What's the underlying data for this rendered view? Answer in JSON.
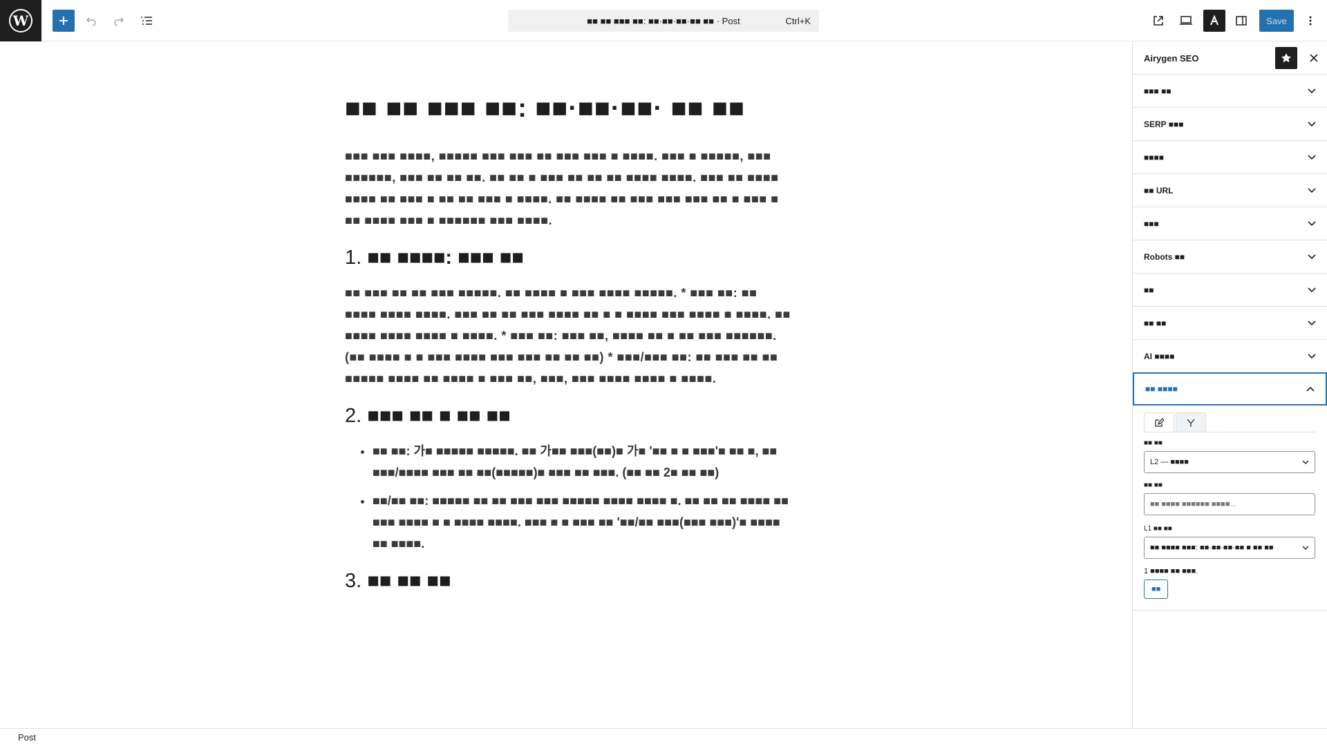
{
  "topbar": {
    "doc_title": "■■ ■■ ■■■ ■■: ■■·■■·■■·■■ ■■ · Post",
    "shortcut": "Ctrl+K",
    "save_label": "Save"
  },
  "post": {
    "title": "■■ ■■ ■■■ ■■: ■■·■■·■■· ■■ ■■",
    "intro": "■■■ ■■■ ■■■■, ■■■■■ ■■■ ■■■ ■■ ■■■ ■■■ ■ ■■■■. ■■■ ■ ■■■■■, ■■■ ■■■■■■, ■■■ ■■ ■■ ■■. ■■ ■■ ■ ■■■ ■■ ■■ ■■ ■■■■ ■■■■. ■■■ ■■ ■■■■ ■■■■ ■■ ■■■ ■ ■■ ■■ ■■■ ■ ■■■■. ■■ ■■■■ ■■ ■■■ ■■■ ■■■ ■■ ■ ■■■ ■ ■■ ■■■■ ■■■ ■ ■■■■■■ ■■■ ■■■■.",
    "h1_num": "1.",
    "h1_text": "■■ ■■■■: ■■■ ■■",
    "p1": "■■ ■■■ ■■ ■■ ■■■ ■■■■■. ■■ ■■■■ ■ ■■■ ■■■■ ■■■■■. * ■■■ ■■: ■■ ■■■■ ■■■■ ■■■■. ■■■ ■■ ■■ ■■■ ■■■■ ■■ ■ ■ ■■■■ ■■■ ■■■■ ■ ■■■■. ■■ ■■■■ ■■■■ ■■■■ ■ ■■■■. * ■■■ ■■: ■■■ ■■, ■■■■ ■■ ■ ■■ ■■■ ■■■■■■. (■■ ■■■■ ■ ■ ■■■ ■■■■ ■■■ ■■■ ■■ ■■ ■■) * ■■■/■■■ ■■: ■■ ■■■ ■■ ■■ ■■■■■ ■■■■ ■■ ■■■■ ■ ■■■ ■■, ■■■, ■■■ ■■■■ ■■■■ ■ ■■■■.",
    "h2_num": "2.",
    "h2_text": "■■■ ■■ ■ ■■ ■■",
    "bullets": [
      "■■ ■■: 가■ ■■■■■ ■■■■■. ■■ 가■■ ■■■(■■)■ 가■ '■■ ■ ■ ■■■'■ ■■ ■, ■■ ■■■/■■■■ ■■■ ■■ ■■(■■■■■)■ ■■■ ■■ ■■■. (■■ ■■ 2■ ■■ ■■)",
      "■■/■■ ■■: ■■■■■ ■■ ■■ ■■■ ■■■ ■■■■■ ■■■■ ■■■■ ■. ■■ ■■ ■■ ■■■■ ■■ ■■■ ■■■■ ■ ■ ■■■■ ■■■■. ■■■ ■ ■ ■■■ ■■ '■■/■■ ■■■(■■■ ■■■)'■ ■■■■ ■■ ■■■■."
    ],
    "h3_num": "3.",
    "h3_text": "■■ ■■ ■■"
  },
  "sidebar": {
    "title": "Airygen SEO",
    "panels": [
      "■■■ ■■",
      "SERP ■■■",
      "■■■■",
      "■■ URL",
      "■■■",
      "Robots ■■",
      "■■",
      "■■ ■■",
      "AI ■■■■"
    ],
    "open_panel": "■■ ■■■■",
    "field1_label": "■■ ■■",
    "field1_value": "L2 — ■■■■",
    "field2_label": "■■ ■■",
    "field2_placeholder": "■■ ■■■■ ■■■■■■ ■■■■...",
    "field3_label": "L1 ■■ ■■",
    "field3_value": "■■ ■■■■ ■■■: ■■·■■·■■·■■ ■ ■■ ■■",
    "status": "1 ■■■■ ■■ ■■■.",
    "action_label": "■■"
  },
  "footer": {
    "label": "Post"
  },
  "colors": {
    "accent": "#2271b1",
    "dark": "#1e1e1e"
  }
}
